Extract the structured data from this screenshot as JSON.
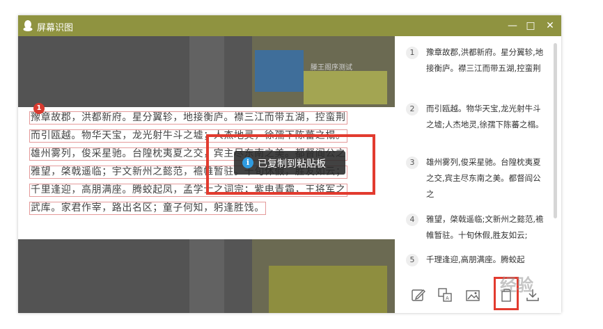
{
  "window": {
    "title": "屏幕识图",
    "minimize_label": "—",
    "maximize_label": "□",
    "close_label": "✕"
  },
  "background": {
    "photo_caption": "滕王阁序测试"
  },
  "ocr": {
    "badge": "1",
    "lines": [
      "豫章故郡，洪都新府。星分翼轸，地接衡庐。襟三江而带五湖，控蛮荆",
      "而引瓯越。物华天宝，龙光射牛斗之墟；人杰地灵，徐孺下陈蕃之榻。",
      "雄州雾列，俊采星驰。台隍枕夷夏之交，宾主尽东南之美。都督阎公之",
      "雅望，棨戟遥临；宇文新州之懿范，襜帷暂驻。十旬休假，胜友如云；",
      "千里逢迎，高朋满座。腾蛟起凤，孟学士之词宗；紫电青霜，王将军之",
      "武库。家君作宰，路出名区；童子何知，躬逢胜饯。"
    ]
  },
  "toast": {
    "icon": "i",
    "text": "已复制到粘贴板"
  },
  "results": [
    {
      "num": "1",
      "text": "豫章故郡,洪都新府。星分翼轸,地接衡庐。襟三江而带五湖,控蛮荆"
    },
    {
      "num": "2",
      "text": "而引瓯越。物华天宝,龙光射牛斗之墟;人杰地灵,徐孺下陈蕃之榻。"
    },
    {
      "num": "3",
      "text": "雄州雾列,俊采星驰。台隍枕夷夏之交,宾主尽东南之美。都督阎公之"
    },
    {
      "num": "4",
      "text": "雅望，棨戟遥临;文新州之懿范,襜帷暂驻。十旬休假,胜友如云;"
    },
    {
      "num": "5",
      "text": "千理逢迎,高朋满座。腾蛟起"
    }
  ],
  "toolbar": {
    "icons": [
      "edit-icon",
      "translate-icon",
      "image-icon",
      "copy-icon",
      "download-icon"
    ]
  },
  "watermark": "经验",
  "colors": {
    "titlebar": "#8f9340",
    "highlight": "#e23b2f",
    "badge": "#d93a2f",
    "info": "#2f9be0"
  }
}
